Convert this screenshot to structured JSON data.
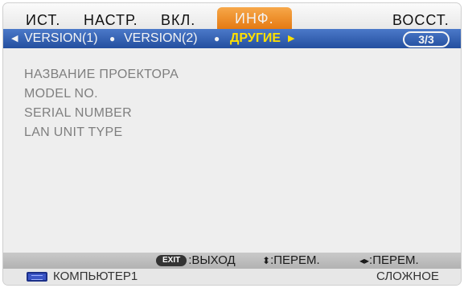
{
  "menu": {
    "tabs": [
      {
        "label": "ИСТ."
      },
      {
        "label": "НАСТР."
      },
      {
        "label": "ВКЛ."
      },
      {
        "label": "ИНФ.",
        "active": true
      },
      {
        "label": "ВОССТ."
      }
    ]
  },
  "submenu": {
    "items": [
      {
        "label": "VERSION(1)"
      },
      {
        "label": "VERSION(2)"
      },
      {
        "label": "ДРУГИЕ",
        "active": true
      }
    ],
    "page_indicator": "3/3"
  },
  "content": {
    "rows": [
      "НАЗВАНИЕ ПРОЕКТОРА",
      "MODEL NO.",
      "SERIAL NUMBER",
      "LAN UNIT TYPE"
    ]
  },
  "footer": {
    "exit_key": "EXIT",
    "exit_label": ":ВЫХОД",
    "updown_label": ":ПЕРЕМ.",
    "leftright_label": ":ПЕРЕМ."
  },
  "status": {
    "source": "КОМПЬЮТЕР1",
    "mode": "СЛОЖНОЕ",
    "source_icon": "computer-input-icon"
  },
  "colors": {
    "active_tab": "#e47810",
    "submenu_bar": "#2f5cae",
    "active_subitem": "#ffe000"
  }
}
